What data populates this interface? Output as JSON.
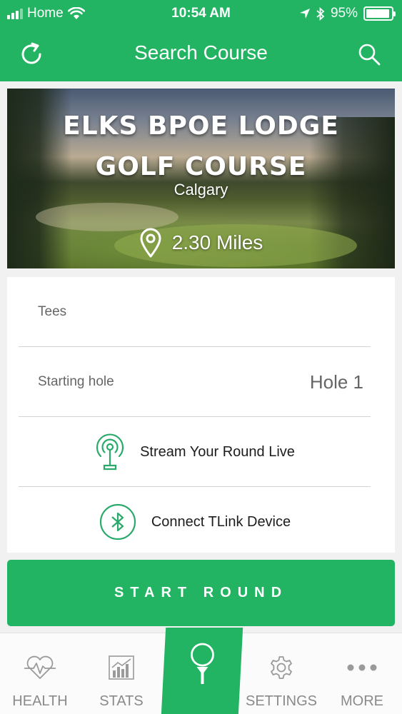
{
  "colors": {
    "brand_green": "#22b463",
    "accent_green": "#2aaa6a",
    "tab_gray": "#8a8a8a"
  },
  "status_bar": {
    "carrier": "Home",
    "time": "10:54 AM",
    "battery": "95%",
    "battery_level": 0.95,
    "icons": [
      "signal-icon",
      "wifi-icon",
      "location-arrow-icon",
      "bluetooth-icon",
      "battery-icon"
    ]
  },
  "nav": {
    "title": "Search Course",
    "left_icon": "refresh-icon",
    "right_icon": "search-icon"
  },
  "course": {
    "name_line1": "ELKS BPOE LODGE",
    "name_line2": "GOLF COURSE",
    "city": "Calgary",
    "distance": "2.30 Miles",
    "distance_icon": "map-pin-icon"
  },
  "options": {
    "tees_label": "Tees",
    "starting_hole_label": "Starting hole",
    "starting_hole_value": "Hole 1",
    "stream_label": "Stream Your Round Live",
    "stream_icon": "broadcast-antenna-icon",
    "connect_label": "Connect TLink Device",
    "connect_icon": "bluetooth-icon"
  },
  "start_button": "START ROUND",
  "tabs": [
    {
      "label": "HEALTH",
      "icon": "heart-pulse-icon"
    },
    {
      "label": "STATS",
      "icon": "bar-chart-icon"
    },
    {
      "label": "",
      "icon": "golf-ball-tee-icon"
    },
    {
      "label": "SETTINGS",
      "icon": "gear-icon"
    },
    {
      "label": "MORE",
      "icon": "more-dots-icon"
    }
  ]
}
